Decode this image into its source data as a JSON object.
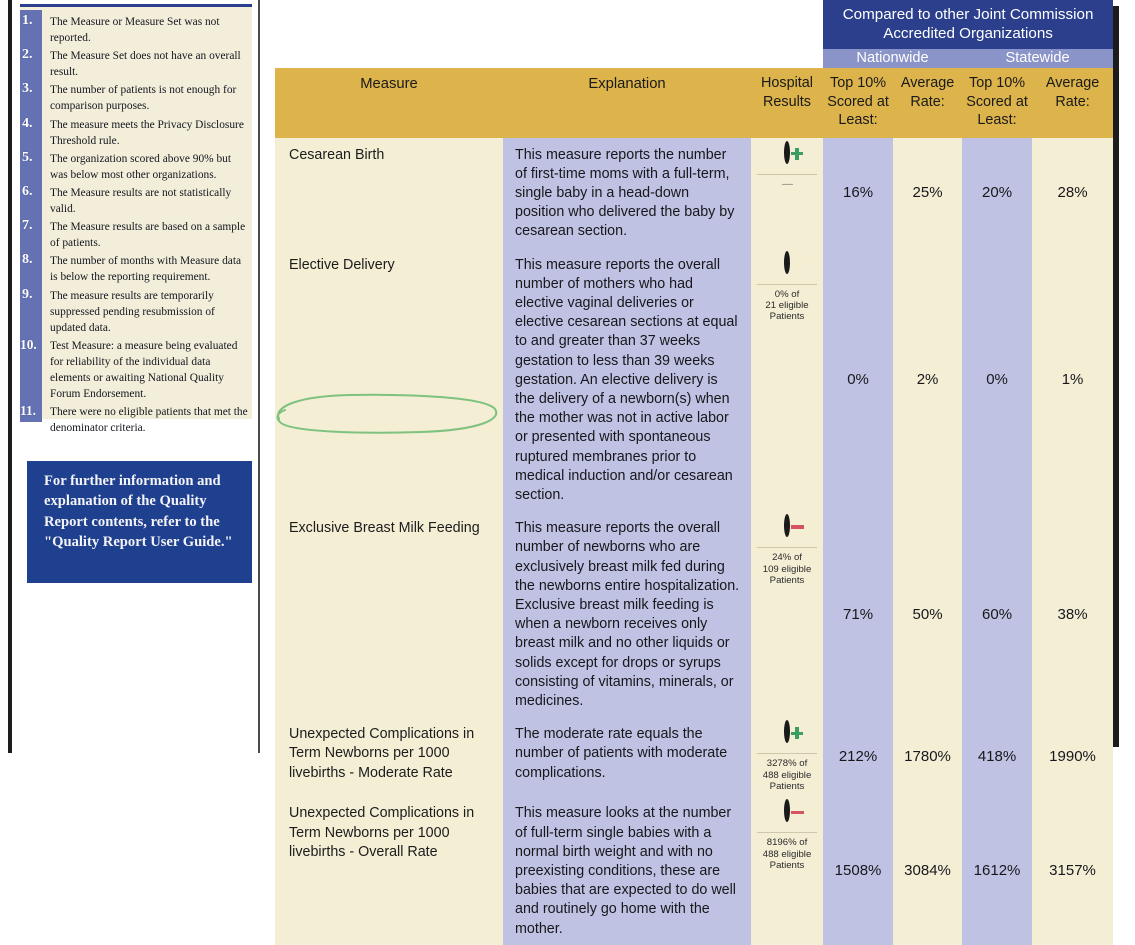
{
  "notes": {
    "items": [
      {
        "num": "1.",
        "text": "The Measure or Measure Set was not reported."
      },
      {
        "num": "2.",
        "text": "The Measure Set does not have an overall result."
      },
      {
        "num": "3.",
        "text": "The number of patients is not enough for comparison purposes."
      },
      {
        "num": "4.",
        "text": "The measure meets the Privacy Disclosure Threshold rule."
      },
      {
        "num": "5.",
        "text": "The organization scored above 90% but was below most other organizations."
      },
      {
        "num": "6.",
        "text": "The Measure results are not statistically valid."
      },
      {
        "num": "7.",
        "text": "The Measure results are based on a sample of patients."
      },
      {
        "num": "8.",
        "text": "The number of months with Measure data is below the reporting requirement."
      },
      {
        "num": "9.",
        "text": "The measure results are temporarily suppressed pending resubmission of updated data."
      },
      {
        "num": "10.",
        "text": "Test Measure: a measure being evaluated for reliability of the individual data elements or awaiting National Quality Forum Endorsement."
      },
      {
        "num": "11.",
        "text": "There were no eligible patients that met the denominator criteria."
      }
    ]
  },
  "info_box": {
    "text": "For further information and explanation of the Quality Report contents, refer to the \"Quality Report User Guide.\""
  },
  "table": {
    "group_header": "Compared to other Joint Commission Accredited Organizations",
    "regions": {
      "nationwide": "Nationwide",
      "statewide": "Statewide"
    },
    "columns": {
      "measure": "Measure",
      "explanation": "Explanation",
      "hospital_results": "Hospital Results",
      "nationwide_top10": "Top 10% Scored at Least:",
      "nationwide_average": "Average Rate:",
      "statewide_top10": "Top 10% Scored at Least:",
      "statewide_average": "Average Rate:"
    },
    "rows": [
      {
        "measure": "Cesarean Birth",
        "explanation": "This measure reports the number of first-time moms with a full-term, single baby in a head-down position who delivered the baby by cesarean section.",
        "icon": "plus-circle-icon",
        "icon_color": "#3a9d62",
        "caption": "-----",
        "nationwide_top10": "16%",
        "nationwide_average": "25%",
        "statewide_top10": "20%",
        "statewide_average": "28%"
      },
      {
        "measure": "Elective Delivery",
        "explanation": "This measure reports the overall number of mothers who had elective vaginal deliveries or elective cesarean sections at equal to and greater than 37 weeks gestation to less than 39 weeks gestation. An elective delivery is the delivery of a newborn(s) when the mother was not in active labor or presented with spontaneous ruptured membranes prior to medical induction and/or cesarean section.",
        "icon": "star-circle-icon",
        "icon_color": "#c79a3f",
        "caption": "0% of\n21 eligible\nPatients",
        "nationwide_top10": "0%",
        "nationwide_average": "2%",
        "statewide_top10": "0%",
        "statewide_average": "1%"
      },
      {
        "measure": "Exclusive Breast Milk Feeding",
        "explanation": "This measure reports the overall number of newborns who are exclusively breast milk fed during the newborns entire hospitalization. Exclusive breast milk feeding is when a newborn receives only breast milk and no other liquids or solids except for drops or syrups consisting of vitamins, minerals, or medicines.",
        "icon": "minus-circle-icon",
        "icon_color": "#d4555f",
        "caption": "24% of\n109 eligible\nPatients",
        "nationwide_top10": "71%",
        "nationwide_average": "50%",
        "statewide_top10": "60%",
        "statewide_average": "38%",
        "annotated": true
      },
      {
        "measure": "Unexpected Complications in Term Newborns per 1000 livebirths - Moderate Rate",
        "explanation": "The moderate rate equals the number of patients with moderate complications.",
        "icon": "plus-circle-icon",
        "icon_color": "#3a9d62",
        "caption": "3278% of\n488 eligible\nPatients",
        "nationwide_top10": "212%",
        "nationwide_average": "1780%",
        "statewide_top10": "418%",
        "statewide_average": "1990%"
      },
      {
        "measure": "Unexpected Complications in Term Newborns per 1000 livebirths - Overall Rate",
        "explanation": "This measure looks at the number of full-term single babies with a normal birth weight and with no preexisting conditions, these are babies that are expected to do well and routinely go home with the mother.",
        "icon": "minus-circle-icon",
        "icon_color": "#d4555f",
        "caption": "8196% of\n488 eligible\nPatients",
        "nationwide_top10": "1508%",
        "nationwide_average": "3084%",
        "statewide_top10": "1612%",
        "statewide_average": "3157%"
      }
    ]
  },
  "annotation": {
    "type": "hand-drawn-ellipse",
    "color": "#7ec27e",
    "targets": "Exclusive Breast Milk Feeding"
  },
  "colors": {
    "header_dark_blue": "#2b3f8c",
    "header_mid_blue": "#8b94c8",
    "header_gold": "#ddb44b",
    "cell_cream": "#f4eed5",
    "cell_blue": "#bfc2e2",
    "info_box_blue": "#1f3f8f",
    "rail_blue": "#6471b3"
  }
}
